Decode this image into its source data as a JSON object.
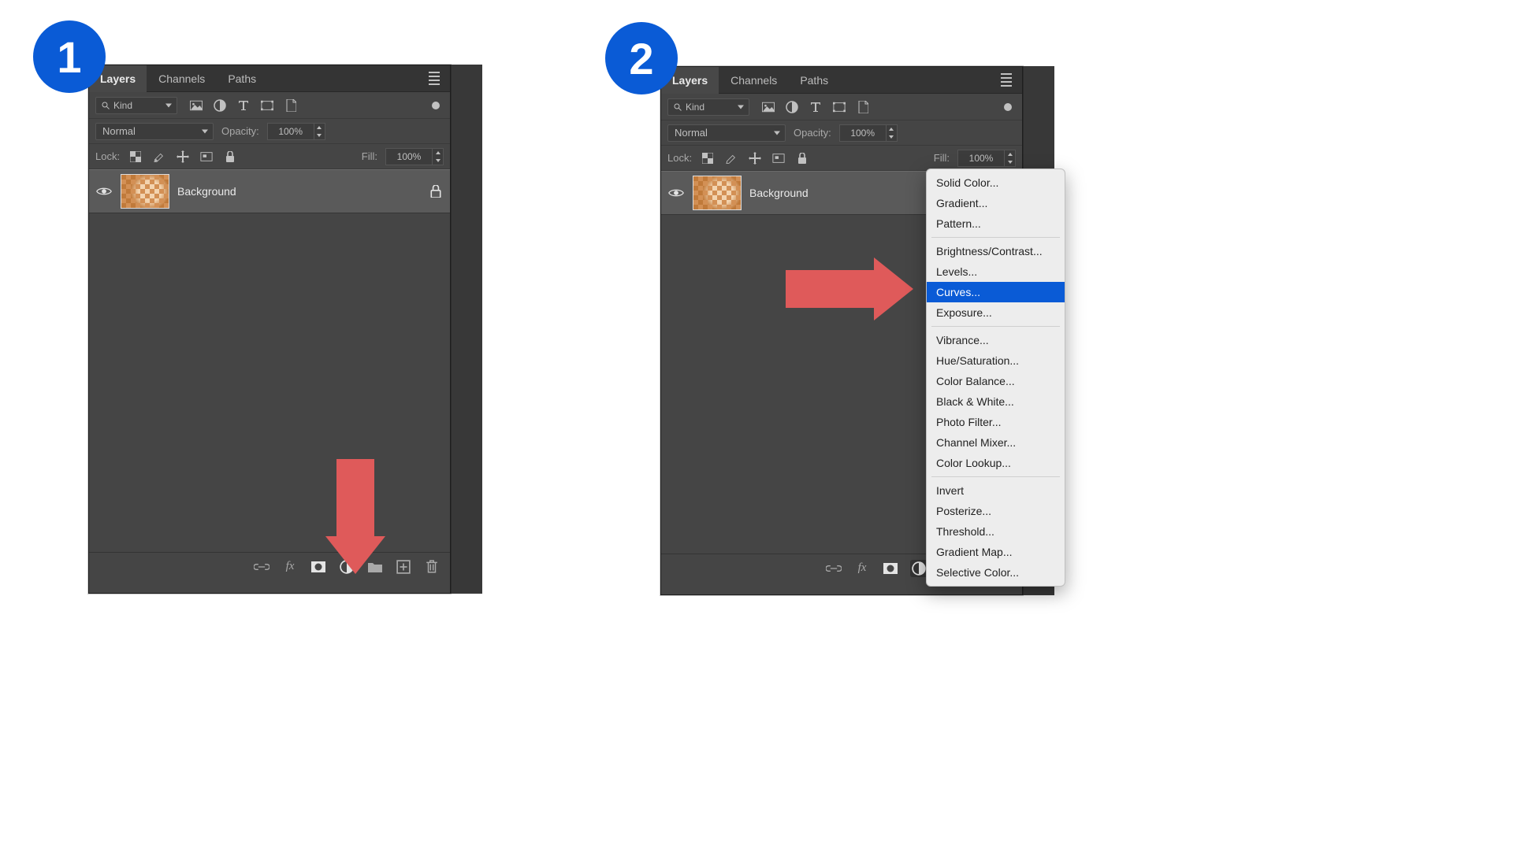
{
  "steps": {
    "one": "1",
    "two": "2"
  },
  "panel": {
    "tabs": [
      "Layers",
      "Channels",
      "Paths"
    ],
    "active_tab": 0,
    "filter_kind_label": "Kind",
    "blend_mode": "Normal",
    "opacity_label": "Opacity:",
    "opacity_value": "100%",
    "lock_label": "Lock:",
    "fill_label": "Fill:",
    "fill_value": "100%",
    "layer": {
      "name": "Background",
      "visible": true,
      "locked": true
    },
    "footer_icons": [
      "link-layers-icon",
      "layer-effects-icon",
      "layer-mask-icon",
      "adjustment-layer-icon",
      "group-icon",
      "new-layer-icon",
      "delete-layer-icon"
    ]
  },
  "adjustment_menu": {
    "groups": [
      [
        "Solid Color...",
        "Gradient...",
        "Pattern..."
      ],
      [
        "Brightness/Contrast...",
        "Levels...",
        "Curves...",
        "Exposure..."
      ],
      [
        "Vibrance...",
        "Hue/Saturation...",
        "Color Balance...",
        "Black & White...",
        "Photo Filter...",
        "Channel Mixer...",
        "Color Lookup..."
      ],
      [
        "Invert",
        "Posterize...",
        "Threshold...",
        "Gradient Map...",
        "Selective Color..."
      ]
    ],
    "highlighted": "Curves..."
  }
}
